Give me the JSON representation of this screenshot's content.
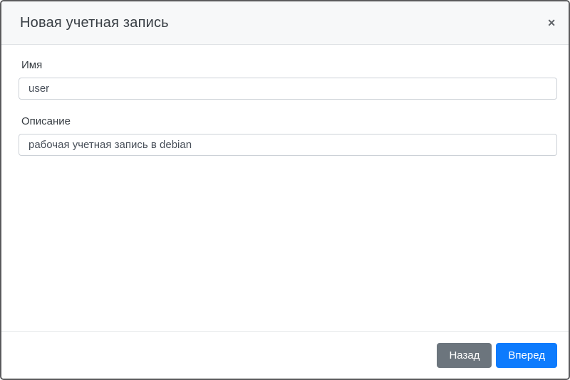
{
  "dialog": {
    "title": "Новая учетная запись",
    "close_icon": "✕"
  },
  "form": {
    "fields": [
      {
        "label": "Имя",
        "value": "user"
      },
      {
        "label": "Описание",
        "value": "рабочая учетная запись в debian"
      }
    ]
  },
  "footer": {
    "back_label": "Назад",
    "forward_label": "Вперед"
  },
  "colors": {
    "primary": "#0d7bfd",
    "secondary": "#6c757d",
    "header_bg": "#f7f8f9",
    "border_dark": "#5a5a5c"
  }
}
